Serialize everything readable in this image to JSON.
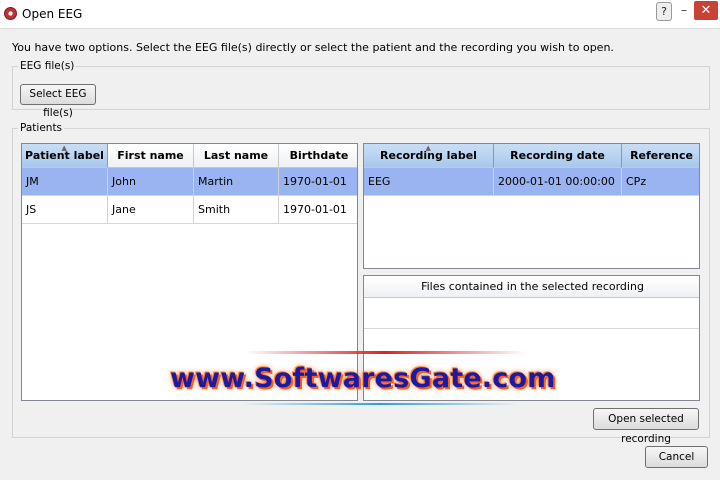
{
  "window": {
    "title": "Open EEG",
    "help_label": "?",
    "minimize_label": "–",
    "close_label": "✕"
  },
  "instruction": "You have two options. Select the EEG file(s) directly or select the patient and the recording you wish to open.",
  "eeg_files": {
    "section_label": "EEG file(s)",
    "select_button": "Select EEG file(s)"
  },
  "patients": {
    "section_label": "Patients",
    "columns": [
      "Patient label",
      "First name",
      "Last name",
      "Birthdate"
    ],
    "rows": [
      [
        "JM",
        "John",
        "Martin",
        "1970-01-01"
      ],
      [
        "JS",
        "Jane",
        "Smith",
        "1970-01-01"
      ]
    ],
    "selected_row": 0
  },
  "recordings": {
    "columns": [
      "Recording label",
      "Recording date",
      "Reference"
    ],
    "rows": [
      [
        "EEG",
        "2000-01-01 00:00:00",
        "CPz"
      ]
    ],
    "selected_row": 0
  },
  "files": {
    "header": "Files contained in the selected recording"
  },
  "buttons": {
    "open_recording": "Open selected recording",
    "cancel": "Cancel"
  },
  "watermark": "www.SoftwaresGate.com",
  "colors": {
    "selection": "#99b4f0",
    "header_selected": "#a9c8ec",
    "close_button": "#c94235"
  }
}
